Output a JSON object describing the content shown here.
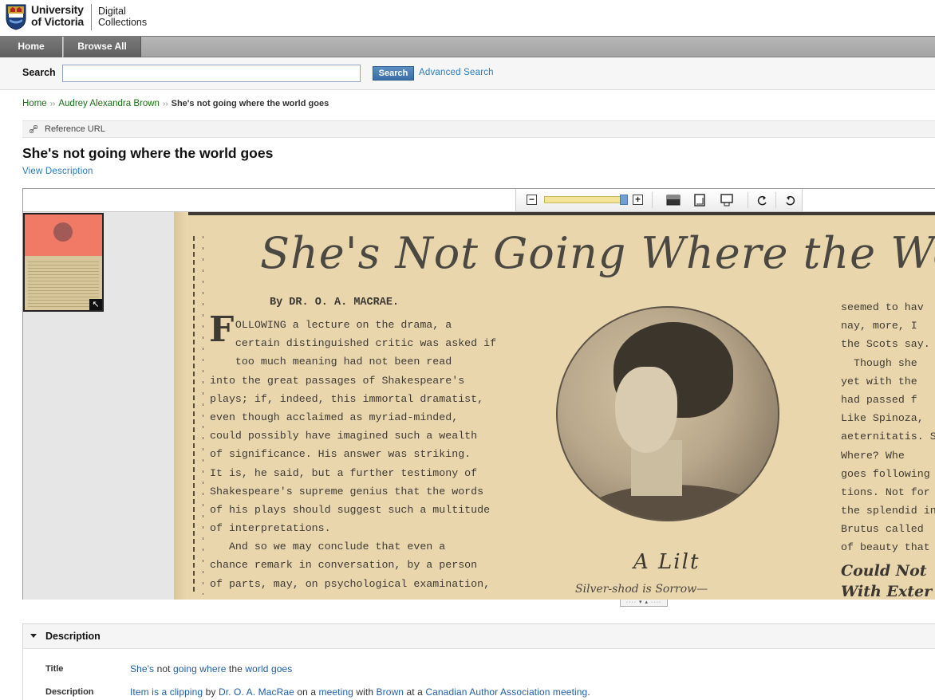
{
  "header": {
    "logo_line1": "University",
    "logo_line2": "of Victoria",
    "site_line1": "Digital",
    "site_line2": "Collections"
  },
  "nav": {
    "items": [
      {
        "label": "Home"
      },
      {
        "label": "Browse All"
      }
    ]
  },
  "search": {
    "label": "Search",
    "value": "",
    "button_label": "Search",
    "advanced_link": "Advanced Search"
  },
  "breadcrumb": {
    "items": [
      {
        "label": "Home"
      },
      {
        "label": "Audrey Alexandra Brown"
      }
    ],
    "current": "She's not going where the world goes",
    "separator": "››"
  },
  "reference": {
    "label": "Reference URL"
  },
  "page": {
    "title": "She's not going where the world goes",
    "view_description": "View Description"
  },
  "viewer": {
    "zoom_level": 0.95,
    "toolbar_icons": [
      "zoom-out-icon",
      "zoom-slider",
      "zoom-in-icon",
      "fit-window-icon",
      "fit-height-icon",
      "fit-width-icon",
      "rotate-left-icon",
      "rotate-right-icon"
    ],
    "zoom_minus": "−",
    "zoom_plus": "+",
    "thumb_expand": "↖",
    "resize_glyph": "···· ▾ ▴ ····",
    "scan": {
      "headline": "She's Not Going Where the Wor",
      "byline": "By DR. O. A. MACRAE.",
      "dropcap": "F",
      "left_column": [
        "    OLLOWING a lecture on the drama, a",
        "    certain distinguished critic was asked if",
        "    too much meaning had not been read",
        "into the great passages of Shakespeare's",
        "plays; if, indeed, this immortal dramatist,",
        "even though acclaimed as myriad-minded,",
        "could possibly have imagined such a wealth",
        "of significance.  His answer was striking.",
        "It is, he said, but a further testimony of",
        "Shakespeare's supreme genius that the words",
        "of his plays should suggest such a multitude",
        "of interpretations.",
        "   And so we may conclude that even a",
        "chance remark in conversation, by a person",
        "of parts, may, on psychological examination,"
      ],
      "right_column": [
        "seemed to hav",
        "nay, more, I",
        "the Scots say.",
        "  Though she",
        "yet with the",
        "had passed f",
        "Like Spinoza,",
        "aeternitatis. S",
        "Where?  Whe",
        "goes following",
        "tions.  Not for",
        "the splendid in",
        "Brutus called",
        "of beauty that"
      ],
      "caption": "A Lilt",
      "caption_sub": "Silver-shod is Sorrow—",
      "right_subhead_1": "Could Not",
      "right_subhead_2": "With Exter"
    }
  },
  "description": {
    "heading": "Description",
    "fields": [
      {
        "label": "Title",
        "value": "She's not going where the world goes"
      },
      {
        "label": "Description",
        "value": "Item is a clipping by Dr. O. A. MacRae on a meeting with Brown at a Canadian Author Association meeting."
      }
    ],
    "title_parts": [
      "She's",
      " not ",
      "going where",
      " the ",
      "world goes"
    ],
    "desc_parts": [
      "Item is a",
      " ",
      "clipping",
      " by ",
      "Dr. O. A. MacRae",
      " on a ",
      "meeting",
      " with ",
      "Brown",
      " at a ",
      "Canadian Author Association meeting",
      "."
    ]
  },
  "colors": {
    "link": "#2a7bbf",
    "breadcrumb_link": "#1a6f1a",
    "nav_active": "#6a6a6a",
    "search_button": "#3b6ea8",
    "scan_paper": "#e9d6ad",
    "zoom_track": "#f2e59a"
  }
}
